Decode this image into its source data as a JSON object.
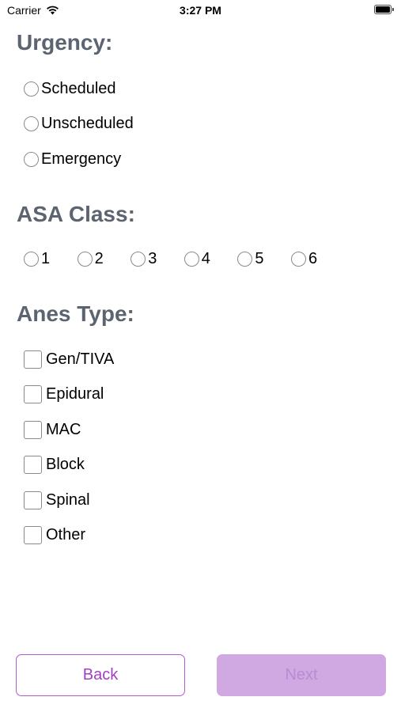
{
  "status_bar": {
    "carrier": "Carrier",
    "time": "3:27 PM",
    "wifi_icon": "wifi-icon",
    "battery_icon": "battery-icon"
  },
  "urgency": {
    "title": "Urgency:",
    "options": [
      "Scheduled",
      "Unscheduled",
      "Emergency"
    ]
  },
  "asa_class": {
    "title": "ASA Class:",
    "options": [
      "1",
      "2",
      "3",
      "4",
      "5",
      "6"
    ]
  },
  "anes_type": {
    "title": "Anes Type:",
    "options": [
      "Gen/TIVA",
      "Epidural",
      "MAC",
      "Block",
      "Spinal",
      "Other"
    ]
  },
  "buttons": {
    "back_label": "Back",
    "next_label": "Next"
  },
  "colors": {
    "section_title": "#5b6470",
    "accent": "#a13fc4",
    "next_disabled_bg": "#d0a9e3"
  }
}
